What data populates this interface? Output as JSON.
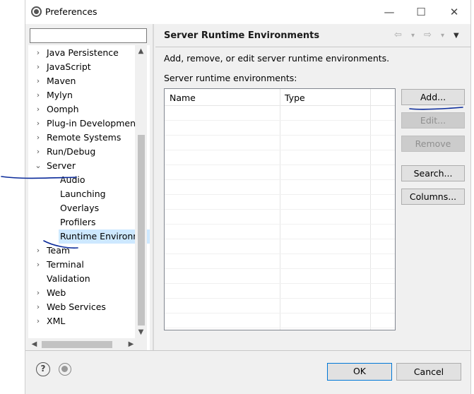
{
  "window": {
    "title": "Preferences",
    "minimize_glyph": "—",
    "maximize_glyph": "☐",
    "close_glyph": "✕"
  },
  "tree": {
    "filter_value": "",
    "items": [
      {
        "label": "Java Persistence",
        "level": 0,
        "expander": "collapsed"
      },
      {
        "label": "JavaScript",
        "level": 0,
        "expander": "collapsed"
      },
      {
        "label": "Maven",
        "level": 0,
        "expander": "collapsed"
      },
      {
        "label": "Mylyn",
        "level": 0,
        "expander": "collapsed"
      },
      {
        "label": "Oomph",
        "level": 0,
        "expander": "collapsed"
      },
      {
        "label": "Plug-in Development",
        "level": 0,
        "expander": "collapsed"
      },
      {
        "label": "Remote Systems",
        "level": 0,
        "expander": "collapsed"
      },
      {
        "label": "Run/Debug",
        "level": 0,
        "expander": "collapsed"
      },
      {
        "label": "Server",
        "level": 0,
        "expander": "expanded"
      },
      {
        "label": "Audio",
        "level": 1,
        "expander": "none"
      },
      {
        "label": "Launching",
        "level": 1,
        "expander": "none"
      },
      {
        "label": "Overlays",
        "level": 1,
        "expander": "none"
      },
      {
        "label": "Profilers",
        "level": 1,
        "expander": "none"
      },
      {
        "label": "Runtime Environm",
        "level": 1,
        "expander": "none",
        "selected": true
      },
      {
        "label": "Team",
        "level": 0,
        "expander": "collapsed"
      },
      {
        "label": "Terminal",
        "level": 0,
        "expander": "collapsed"
      },
      {
        "label": "Validation",
        "level": 0,
        "expander": "none"
      },
      {
        "label": "Web",
        "level": 0,
        "expander": "collapsed"
      },
      {
        "label": "Web Services",
        "level": 0,
        "expander": "collapsed"
      },
      {
        "label": "XML",
        "level": 0,
        "expander": "collapsed"
      }
    ]
  },
  "page": {
    "title": "Server Runtime Environments",
    "description": "Add, remove, or edit server runtime environments.",
    "table_label": "Server runtime environments:",
    "columns": [
      "Name",
      "Type"
    ],
    "rows": []
  },
  "buttons": {
    "add": "Add...",
    "edit": "Edit...",
    "remove": "Remove",
    "search": "Search...",
    "columns": "Columns..."
  },
  "footer": {
    "help_glyph": "?",
    "ok": "OK",
    "cancel": "Cancel"
  },
  "icons": {
    "back": "back-arrow-icon",
    "forward": "forward-arrow-icon",
    "menu": "view-menu-icon",
    "help": "help-icon",
    "record": "record-macro-icon"
  },
  "colors": {
    "selection": "#cde8ff",
    "ok_border": "#0078d7",
    "annotation_ink": "#0a2a9a"
  }
}
